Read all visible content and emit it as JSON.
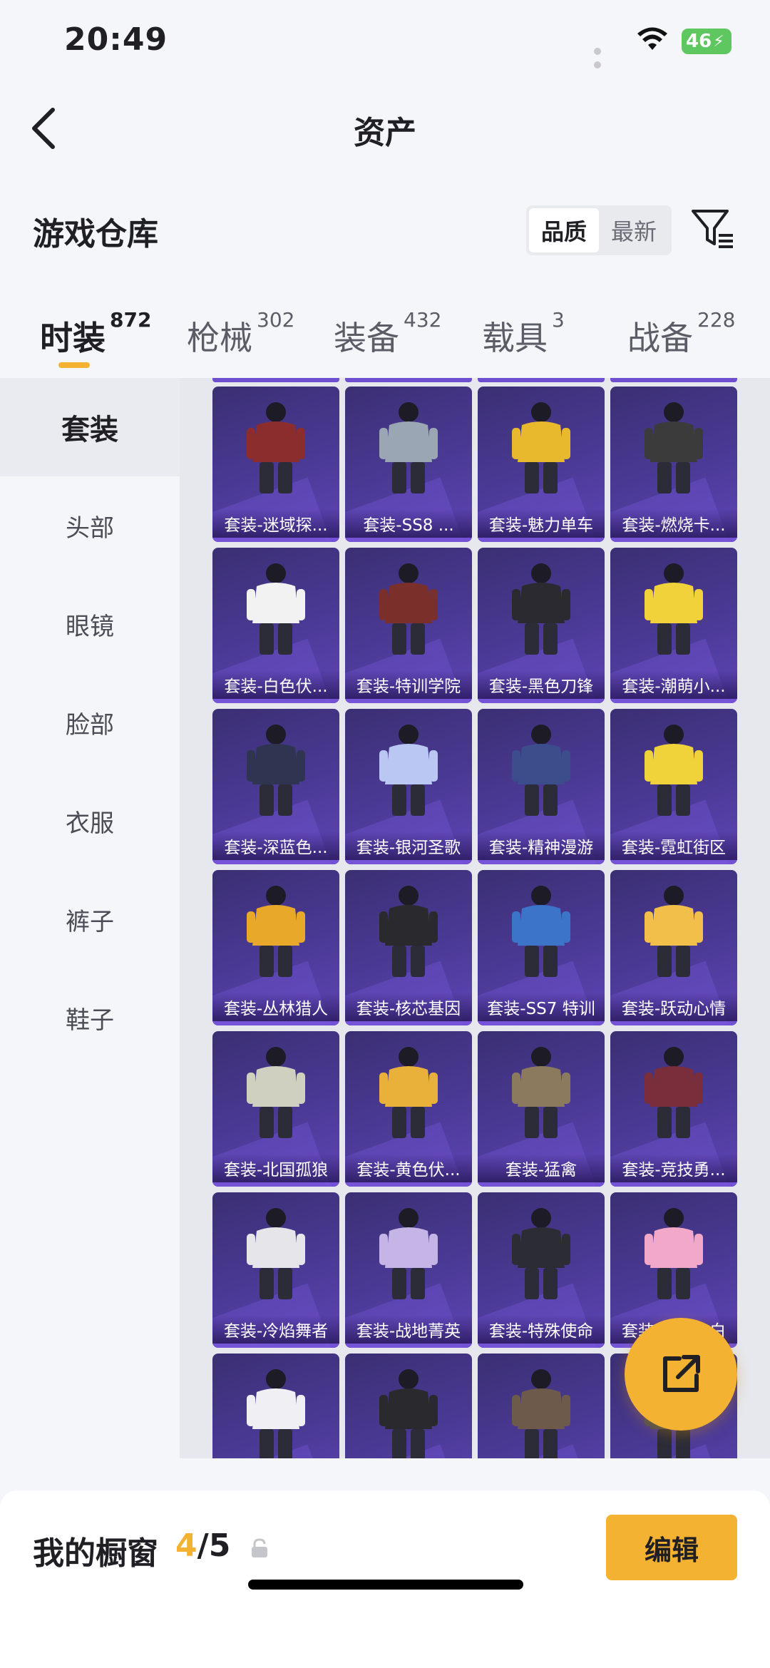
{
  "status": {
    "time": "20:49",
    "battery": "46"
  },
  "nav": {
    "title": "资产"
  },
  "warehouse": {
    "title": "游戏仓库",
    "sort_options": [
      {
        "label": "品质",
        "active": true
      },
      {
        "label": "最新",
        "active": false
      }
    ]
  },
  "category_tabs": [
    {
      "label": "时装",
      "count": "872",
      "active": true
    },
    {
      "label": "枪械",
      "count": "302",
      "active": false
    },
    {
      "label": "装备",
      "count": "432",
      "active": false
    },
    {
      "label": "载具",
      "count": "3",
      "active": false
    },
    {
      "label": "战备",
      "count": "228",
      "active": false
    }
  ],
  "sidebar": {
    "items": [
      {
        "label": "套装",
        "active": true
      },
      {
        "label": "头部",
        "active": false
      },
      {
        "label": "眼镜",
        "active": false
      },
      {
        "label": "脸部",
        "active": false
      },
      {
        "label": "衣服",
        "active": false
      },
      {
        "label": "裤子",
        "active": false
      },
      {
        "label": "鞋子",
        "active": false
      }
    ]
  },
  "items": [
    {
      "name": "套装-迷域探...",
      "accent": "#8b2d2d"
    },
    {
      "name": "套装-SS8 ...",
      "accent": "#9aa6b4"
    },
    {
      "name": "套装-魅力单车",
      "accent": "#e8b92c"
    },
    {
      "name": "套装-燃烧卡...",
      "accent": "#3b3b3b"
    },
    {
      "name": "套装-白色伏...",
      "accent": "#f2f2f2"
    },
    {
      "name": "套装-特训学院",
      "accent": "#7a2f2a"
    },
    {
      "name": "套装-黑色刀锋",
      "accent": "#2a2a30"
    },
    {
      "name": "套装-潮萌小...",
      "accent": "#f2d23a"
    },
    {
      "name": "套装-深蓝色...",
      "accent": "#2f3550"
    },
    {
      "name": "套装-银河圣歌",
      "accent": "#b9c7f2"
    },
    {
      "name": "套装-精神漫游",
      "accent": "#3c4d8c"
    },
    {
      "name": "套装-霓虹街区",
      "accent": "#f0d33a"
    },
    {
      "name": "套装-丛林猎人",
      "accent": "#e8a92a"
    },
    {
      "name": "套装-核芯基因",
      "accent": "#2a2a2e"
    },
    {
      "name": "套装-SS7 特训",
      "accent": "#3b74c8"
    },
    {
      "name": "套装-跃动心情",
      "accent": "#f2c04a"
    },
    {
      "name": "套装-北国孤狼",
      "accent": "#cfd0c0"
    },
    {
      "name": "套装-黄色伏...",
      "accent": "#eab13a"
    },
    {
      "name": "套装-猛禽",
      "accent": "#8c7a5e"
    },
    {
      "name": "套装-竞技勇...",
      "accent": "#7a2d3a"
    },
    {
      "name": "套装-冷焰舞者",
      "accent": "#e6e6ea"
    },
    {
      "name": "套装-战地菁英",
      "accent": "#c5b4e6"
    },
    {
      "name": "套装-特殊使命",
      "accent": "#2c2c34"
    },
    {
      "name": "套装-甜蜜告白",
      "accent": "#f2a8c8"
    },
    {
      "name": "",
      "accent": "#f0f0f4"
    },
    {
      "name": "",
      "accent": "#2a2a2e"
    },
    {
      "name": "",
      "accent": "#6e5a4a"
    },
    {
      "name": "",
      "accent": "#4a4a55"
    }
  ],
  "showcase": {
    "title": "我的橱窗",
    "used": "4",
    "total": "/5",
    "edit_label": "编辑"
  },
  "colors": {
    "accent": "#f4b233",
    "tile_bg": "#4b3a96"
  }
}
